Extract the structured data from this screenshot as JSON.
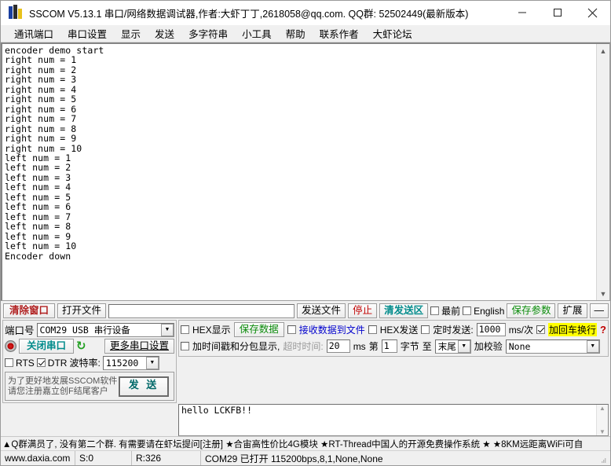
{
  "window": {
    "title": "SSCOM V5.13.1 串口/网络数据调试器,作者:大虾丁丁,2618058@qq.com. QQ群: 52502449(最新版本)",
    "minimize_label": "—",
    "maximize_label": "□",
    "close_label": "✕"
  },
  "menu": {
    "items": [
      {
        "label": "通讯端口"
      },
      {
        "label": "串口设置"
      },
      {
        "label": "显示"
      },
      {
        "label": "发送"
      },
      {
        "label": "多字符串"
      },
      {
        "label": "小工具"
      },
      {
        "label": "帮助"
      },
      {
        "label": "联系作者"
      },
      {
        "label": "大虾论坛"
      }
    ]
  },
  "terminal": {
    "text": "encoder demo start\nright num = 1\nright num = 2\nright num = 3\nright num = 4\nright num = 5\nright num = 6\nright num = 7\nright num = 8\nright num = 9\nright num = 10\nleft num = 1\nleft num = 2\nleft num = 3\nleft num = 4\nleft num = 5\nleft num = 6\nleft num = 7\nleft num = 8\nleft num = 9\nleft num = 10\nEncoder down"
  },
  "toolbar": {
    "clear_window_label": "清除窗口",
    "open_file_label": "打开文件",
    "file_path_value": "",
    "send_file_label": "发送文件",
    "stop_label": "停止",
    "clear_send_label": "清发送区",
    "topmost_label": "最前",
    "topmost_checked": false,
    "english_label": "English",
    "english_checked": false,
    "save_params_label": "保存参数",
    "extend_label": "扩展",
    "collapse_label": "—"
  },
  "port_panel": {
    "port_label": "端口号",
    "port_value": "COM29 USB 串行设备",
    "close_port_label": "关闭串口",
    "refresh_icon": "refresh-icon",
    "more_settings_label": "更多串口设置",
    "rts_label": "RTS",
    "rts_checked": false,
    "dtr_label": "DTR",
    "dtr_checked": true,
    "baud_label": "波特率:",
    "baud_value": "115200",
    "promo_line1": "为了更好地发展SSCOM软件",
    "promo_line2": "请您注册嘉立创F结尾客户",
    "send_button_label": "发 送"
  },
  "recv_panel": {
    "hex_display_label": "HEX显示",
    "hex_display_checked": false,
    "save_data_label": "保存数据",
    "recv_to_file_label": "接收数据到文件",
    "recv_to_file_checked": false,
    "hex_send_label": "HEX发送",
    "hex_send_checked": false,
    "timed_send_label": "定时发送:",
    "timed_send_checked": false,
    "timed_send_value": "1000",
    "ms_unit_label": "ms/次",
    "crlf_label": "加回车换行",
    "crlf_checked": true,
    "help_mark": "?",
    "timestamp_label": "加时间戳和分包显示,",
    "timestamp_checked": false,
    "timeout_label": "超时时间:",
    "timeout_value": "20",
    "timeout_unit": "ms",
    "byte_from_label": "第",
    "byte_from_value": "1",
    "byte_label": "字节",
    "byte_to_label": "至",
    "byte_to_value": "末尾",
    "checksum_label": "加校验",
    "checksum_value": "None"
  },
  "send_area": {
    "text": "hello LCKFB!!"
  },
  "ad_bar": {
    "text": "▲Q群满员了, 没有第二个群. 有需要请在虾坛提问[注册] ★合宙高性价比4G模块  ★RT-Thread中国人的开源免费操作系统 ★  ★8KM远距离WiFi可自"
  },
  "status_bar": {
    "site": "www.daxia.com",
    "sent": "S:0",
    "received": "R:326",
    "connection": "COM29 已打开  115200bps,8,1,None,None"
  },
  "colors": {
    "accent_red": "#b02020",
    "accent_teal": "#008b8b",
    "accent_green": "#0a8a0a",
    "accent_blue": "#0000cd",
    "highlight_yellow": "#ffff00"
  }
}
